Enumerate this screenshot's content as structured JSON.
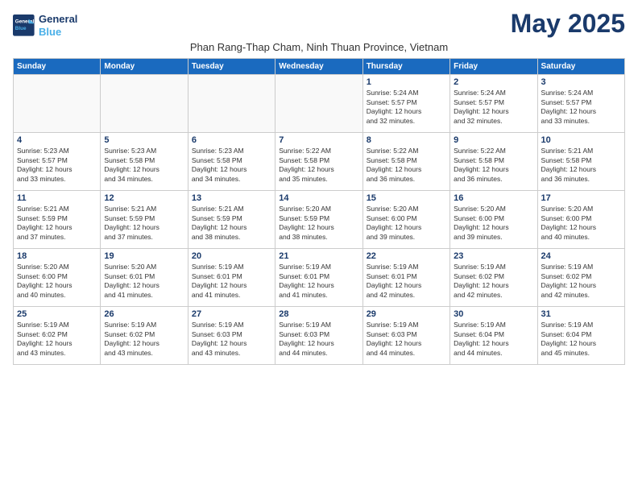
{
  "logo": {
    "line1": "General",
    "line2": "Blue"
  },
  "title": "May 2025",
  "subtitle": "Phan Rang-Thap Cham, Ninh Thuan Province, Vietnam",
  "days_of_week": [
    "Sunday",
    "Monday",
    "Tuesday",
    "Wednesday",
    "Thursday",
    "Friday",
    "Saturday"
  ],
  "weeks": [
    [
      {
        "day": "",
        "detail": ""
      },
      {
        "day": "",
        "detail": ""
      },
      {
        "day": "",
        "detail": ""
      },
      {
        "day": "",
        "detail": ""
      },
      {
        "day": "1",
        "detail": "Sunrise: 5:24 AM\nSunset: 5:57 PM\nDaylight: 12 hours\nand 32 minutes."
      },
      {
        "day": "2",
        "detail": "Sunrise: 5:24 AM\nSunset: 5:57 PM\nDaylight: 12 hours\nand 32 minutes."
      },
      {
        "day": "3",
        "detail": "Sunrise: 5:24 AM\nSunset: 5:57 PM\nDaylight: 12 hours\nand 33 minutes."
      }
    ],
    [
      {
        "day": "4",
        "detail": "Sunrise: 5:23 AM\nSunset: 5:57 PM\nDaylight: 12 hours\nand 33 minutes."
      },
      {
        "day": "5",
        "detail": "Sunrise: 5:23 AM\nSunset: 5:58 PM\nDaylight: 12 hours\nand 34 minutes."
      },
      {
        "day": "6",
        "detail": "Sunrise: 5:23 AM\nSunset: 5:58 PM\nDaylight: 12 hours\nand 34 minutes."
      },
      {
        "day": "7",
        "detail": "Sunrise: 5:22 AM\nSunset: 5:58 PM\nDaylight: 12 hours\nand 35 minutes."
      },
      {
        "day": "8",
        "detail": "Sunrise: 5:22 AM\nSunset: 5:58 PM\nDaylight: 12 hours\nand 36 minutes."
      },
      {
        "day": "9",
        "detail": "Sunrise: 5:22 AM\nSunset: 5:58 PM\nDaylight: 12 hours\nand 36 minutes."
      },
      {
        "day": "10",
        "detail": "Sunrise: 5:21 AM\nSunset: 5:58 PM\nDaylight: 12 hours\nand 36 minutes."
      }
    ],
    [
      {
        "day": "11",
        "detail": "Sunrise: 5:21 AM\nSunset: 5:59 PM\nDaylight: 12 hours\nand 37 minutes."
      },
      {
        "day": "12",
        "detail": "Sunrise: 5:21 AM\nSunset: 5:59 PM\nDaylight: 12 hours\nand 37 minutes."
      },
      {
        "day": "13",
        "detail": "Sunrise: 5:21 AM\nSunset: 5:59 PM\nDaylight: 12 hours\nand 38 minutes."
      },
      {
        "day": "14",
        "detail": "Sunrise: 5:20 AM\nSunset: 5:59 PM\nDaylight: 12 hours\nand 38 minutes."
      },
      {
        "day": "15",
        "detail": "Sunrise: 5:20 AM\nSunset: 6:00 PM\nDaylight: 12 hours\nand 39 minutes."
      },
      {
        "day": "16",
        "detail": "Sunrise: 5:20 AM\nSunset: 6:00 PM\nDaylight: 12 hours\nand 39 minutes."
      },
      {
        "day": "17",
        "detail": "Sunrise: 5:20 AM\nSunset: 6:00 PM\nDaylight: 12 hours\nand 40 minutes."
      }
    ],
    [
      {
        "day": "18",
        "detail": "Sunrise: 5:20 AM\nSunset: 6:00 PM\nDaylight: 12 hours\nand 40 minutes."
      },
      {
        "day": "19",
        "detail": "Sunrise: 5:20 AM\nSunset: 6:01 PM\nDaylight: 12 hours\nand 41 minutes."
      },
      {
        "day": "20",
        "detail": "Sunrise: 5:19 AM\nSunset: 6:01 PM\nDaylight: 12 hours\nand 41 minutes."
      },
      {
        "day": "21",
        "detail": "Sunrise: 5:19 AM\nSunset: 6:01 PM\nDaylight: 12 hours\nand 41 minutes."
      },
      {
        "day": "22",
        "detail": "Sunrise: 5:19 AM\nSunset: 6:01 PM\nDaylight: 12 hours\nand 42 minutes."
      },
      {
        "day": "23",
        "detail": "Sunrise: 5:19 AM\nSunset: 6:02 PM\nDaylight: 12 hours\nand 42 minutes."
      },
      {
        "day": "24",
        "detail": "Sunrise: 5:19 AM\nSunset: 6:02 PM\nDaylight: 12 hours\nand 42 minutes."
      }
    ],
    [
      {
        "day": "25",
        "detail": "Sunrise: 5:19 AM\nSunset: 6:02 PM\nDaylight: 12 hours\nand 43 minutes."
      },
      {
        "day": "26",
        "detail": "Sunrise: 5:19 AM\nSunset: 6:02 PM\nDaylight: 12 hours\nand 43 minutes."
      },
      {
        "day": "27",
        "detail": "Sunrise: 5:19 AM\nSunset: 6:03 PM\nDaylight: 12 hours\nand 43 minutes."
      },
      {
        "day": "28",
        "detail": "Sunrise: 5:19 AM\nSunset: 6:03 PM\nDaylight: 12 hours\nand 44 minutes."
      },
      {
        "day": "29",
        "detail": "Sunrise: 5:19 AM\nSunset: 6:03 PM\nDaylight: 12 hours\nand 44 minutes."
      },
      {
        "day": "30",
        "detail": "Sunrise: 5:19 AM\nSunset: 6:04 PM\nDaylight: 12 hours\nand 44 minutes."
      },
      {
        "day": "31",
        "detail": "Sunrise: 5:19 AM\nSunset: 6:04 PM\nDaylight: 12 hours\nand 45 minutes."
      }
    ]
  ]
}
